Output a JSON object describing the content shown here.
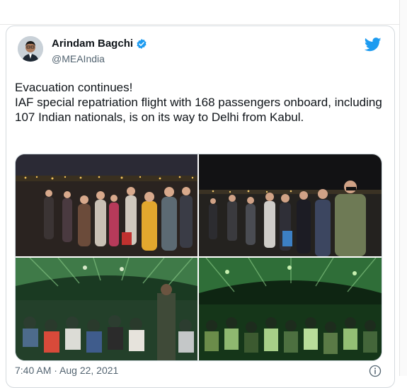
{
  "tweet": {
    "display_name": "Arindam Bagchi",
    "handle": "@MEAIndia",
    "text": "Evacuation continues!\nIAF special repatriation flight with 168 passengers onboard, including 107 Indian nationals, is on its way to Delhi from Kabul.",
    "timestamp": "7:40 AM · Aug 22, 2021",
    "verified": true
  },
  "icons": {
    "verified": "verified-badge-icon",
    "brand": "twitter-bird-icon",
    "info": "info-icon"
  },
  "colors": {
    "brand_blue": "#1d9bf0",
    "text_primary": "#0f1419",
    "text_secondary": "#536471"
  }
}
